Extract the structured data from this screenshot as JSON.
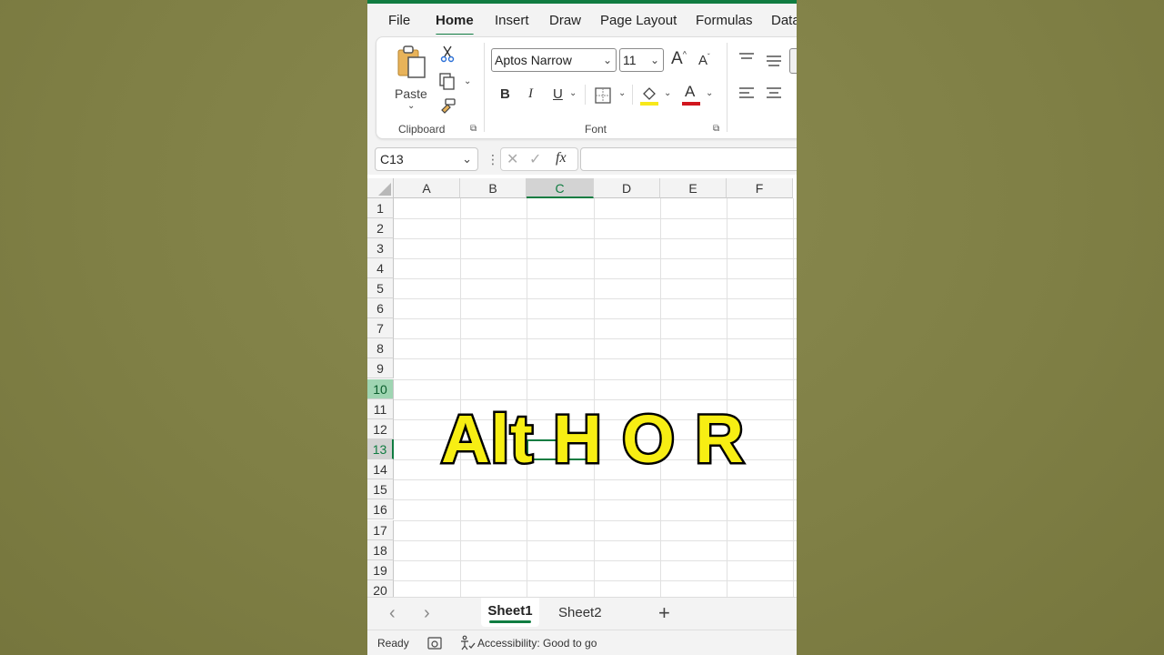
{
  "menu": {
    "tabs": [
      "File",
      "Home",
      "Insert",
      "Draw",
      "Page Layout",
      "Formulas",
      "Data"
    ],
    "active": "Home"
  },
  "ribbon": {
    "clipboard": {
      "paste_label": "Paste",
      "group_label": "Clipboard"
    },
    "font": {
      "font_name": "Aptos Narrow",
      "font_size": "11",
      "group_label": "Font",
      "bold": "B",
      "italic": "I",
      "underline": "U",
      "font_color_letter": "A",
      "highlight_color": "#f7e81a",
      "font_color": "#d1161e"
    }
  },
  "formula_bar": {
    "name_box": "C13",
    "fx": "fx",
    "formula": ""
  },
  "grid": {
    "columns": [
      "A",
      "B",
      "C",
      "D",
      "E",
      "F"
    ],
    "selected_column": "C",
    "rows": [
      "1",
      "2",
      "3",
      "4",
      "5",
      "6",
      "7",
      "8",
      "9",
      "10",
      "11",
      "12",
      "13",
      "14",
      "15",
      "16",
      "17",
      "18",
      "19",
      "20"
    ],
    "highlighted_row": "10",
    "active_row": "13"
  },
  "sheets": {
    "tabs": [
      "Sheet1",
      "Sheet2"
    ],
    "active": "Sheet1",
    "add_label": "+"
  },
  "status": {
    "ready": "Ready",
    "accessibility": "Accessibility: Good to go"
  },
  "overlay": {
    "caption": "Alt H O R"
  },
  "colors": {
    "accent": "#107c41",
    "caption_fill": "#f7ee13",
    "background": "#808048"
  }
}
